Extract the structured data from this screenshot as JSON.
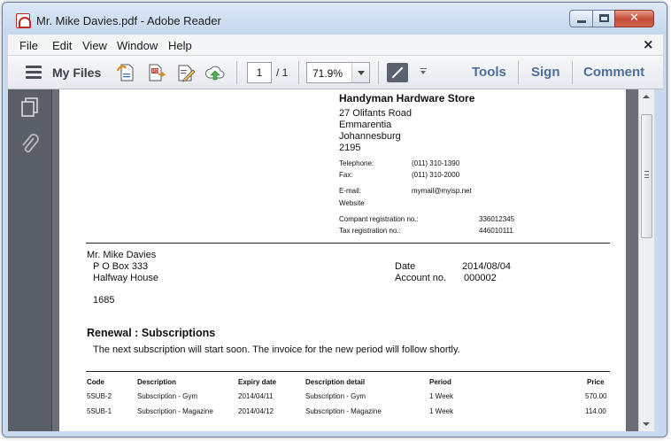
{
  "window": {
    "title": "Mr. Mike Davies.pdf - Adobe Reader",
    "close_glyph": "✕"
  },
  "menu": {
    "items": [
      "File",
      "Edit",
      "View",
      "Window",
      "Help"
    ],
    "close_glyph": "×"
  },
  "toolbar": {
    "my_files": "My Files",
    "page_current": "1",
    "page_total": "/ 1",
    "zoom": "71.9%",
    "tools": "Tools",
    "sign": "Sign",
    "comment": "Comment",
    "icons": [
      "create-pdf-icon",
      "export-pdf-icon",
      "fill-sign-icon",
      "upload-cloud-icon",
      "fit-page-icon"
    ]
  },
  "document": {
    "store": {
      "name": "Handyman Hardware Store",
      "address": [
        "27 Olifants Road",
        "Emmarentia",
        "Johannesburg",
        "2195"
      ],
      "telephone_label": "Telephone:",
      "telephone": "(011) 310-1390",
      "fax_label": "Fax:",
      "fax": "(011) 310-2000",
      "email_label": "E-mail:",
      "email": "mymail@myisp.net",
      "website_label": "Website",
      "company_reg_label": "Compant registration no.:",
      "company_reg": "336012345",
      "tax_reg_label": "Tax registration no.:",
      "tax_reg": "446010111"
    },
    "customer": {
      "name": "Mr. Mike Davies",
      "address": [
        "P O Box 333",
        "Halfway House"
      ],
      "postcode": "1685",
      "date_label": "Date",
      "date": "2014/08/04",
      "account_label": "Account no.",
      "account": "000002"
    },
    "heading": "Renewal : Subscriptions",
    "message": "The next subscription will start soon. The invoice for the new period will follow shortly.",
    "table": {
      "headers": [
        "Code",
        "Description",
        "Expiry date",
        "Description detail",
        "Period",
        "Price"
      ],
      "rows": [
        [
          "5SUB-2",
          "Subscription - Gym",
          "2014/04/11",
          "Subscription - Gym",
          "1 Week",
          "570.00"
        ],
        [
          "5SUB-1",
          "Subscription - Magazine",
          "2014/04/12",
          "Subscription - Magazine",
          "1 Week",
          "114.00"
        ]
      ]
    }
  },
  "nav_icons": [
    "pages-icon",
    "attachment-icon"
  ]
}
